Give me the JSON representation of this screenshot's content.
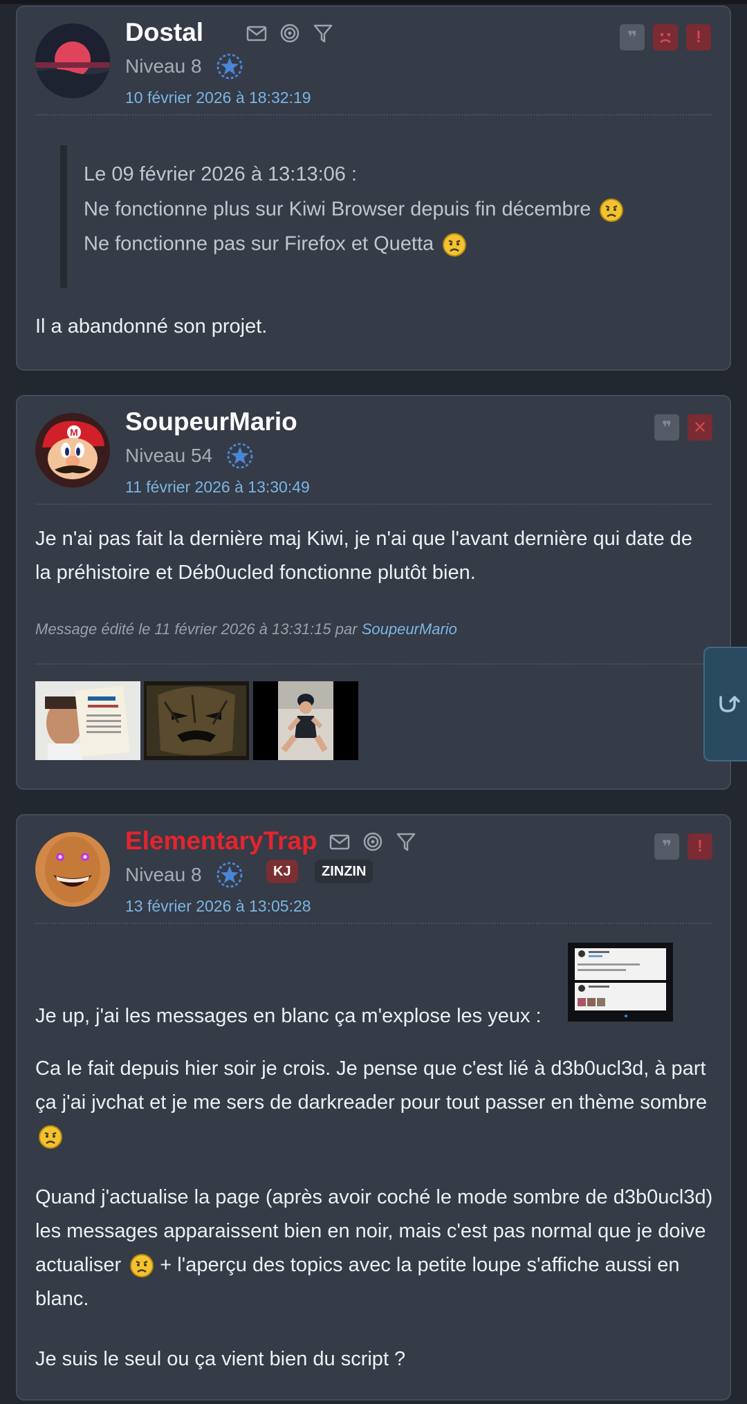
{
  "posts": [
    {
      "author": "Dostal",
      "level": "Niveau 8",
      "date": "10 février 2026 à 18:32:19",
      "quote": {
        "header": "Le 09 février 2026 à 13:13:06 :",
        "lines": [
          "Ne fonctionne plus sur Kiwi Browser depuis fin décembre",
          "Ne fonctionne pas sur Firefox et Quetta"
        ]
      },
      "body": "Il a abandonné son projet.",
      "actions": [
        "quote-icon",
        "sad-icon",
        "alert-icon"
      ],
      "header_icons": [
        "mail-icon",
        "spiral-icon",
        "filter-icon"
      ]
    },
    {
      "author": "SoupeurMario",
      "level": "Niveau 54",
      "date": "11 février 2026 à 13:30:49",
      "body": "Je n'ai pas fait la dernière maj Kiwi, je n'ai que l'avant dernière qui date de la préhistoire et Déb0ucled fonctionne plutôt bien.",
      "edited_prefix": "Message édité le 11 février 2026 à 13:31:15 par",
      "edited_by": "SoupeurMario",
      "actions": [
        "quote-icon",
        "close-icon"
      ]
    },
    {
      "author": "ElementaryTrap",
      "level": "Niveau 8",
      "badges": [
        "KJ",
        "ZINZIN"
      ],
      "date": "13 février 2026 à 13:05:28",
      "paragraphs": [
        "Je up, j'ai les messages en blanc ça m'explose les yeux :",
        "Ca le fait depuis hier soir je crois. Je pense que c'est lié à d3b0ucl3d, à part ça j'ai jvchat et je me sers de darkreader pour tout passer en thème sombre",
        "Quand j'actualise la page (après avoir coché le mode sombre de d3b0ucl3d) les messages apparaissent bien en noir, mais c'est pas normal que je doive actualiser",
        "+ l'aperçu des topics avec la petite loupe s'affiche aussi en blanc.",
        "Je suis le seul ou ça vient bien du script ?"
      ],
      "actions": [
        "quote-icon",
        "alert-icon"
      ],
      "header_icons": [
        "mail-icon",
        "spiral-icon",
        "filter-icon"
      ]
    }
  ],
  "colors": {
    "background": "#232730",
    "card": "#353b47",
    "link": "#7ab6e3",
    "author_red": "#e3252e"
  }
}
